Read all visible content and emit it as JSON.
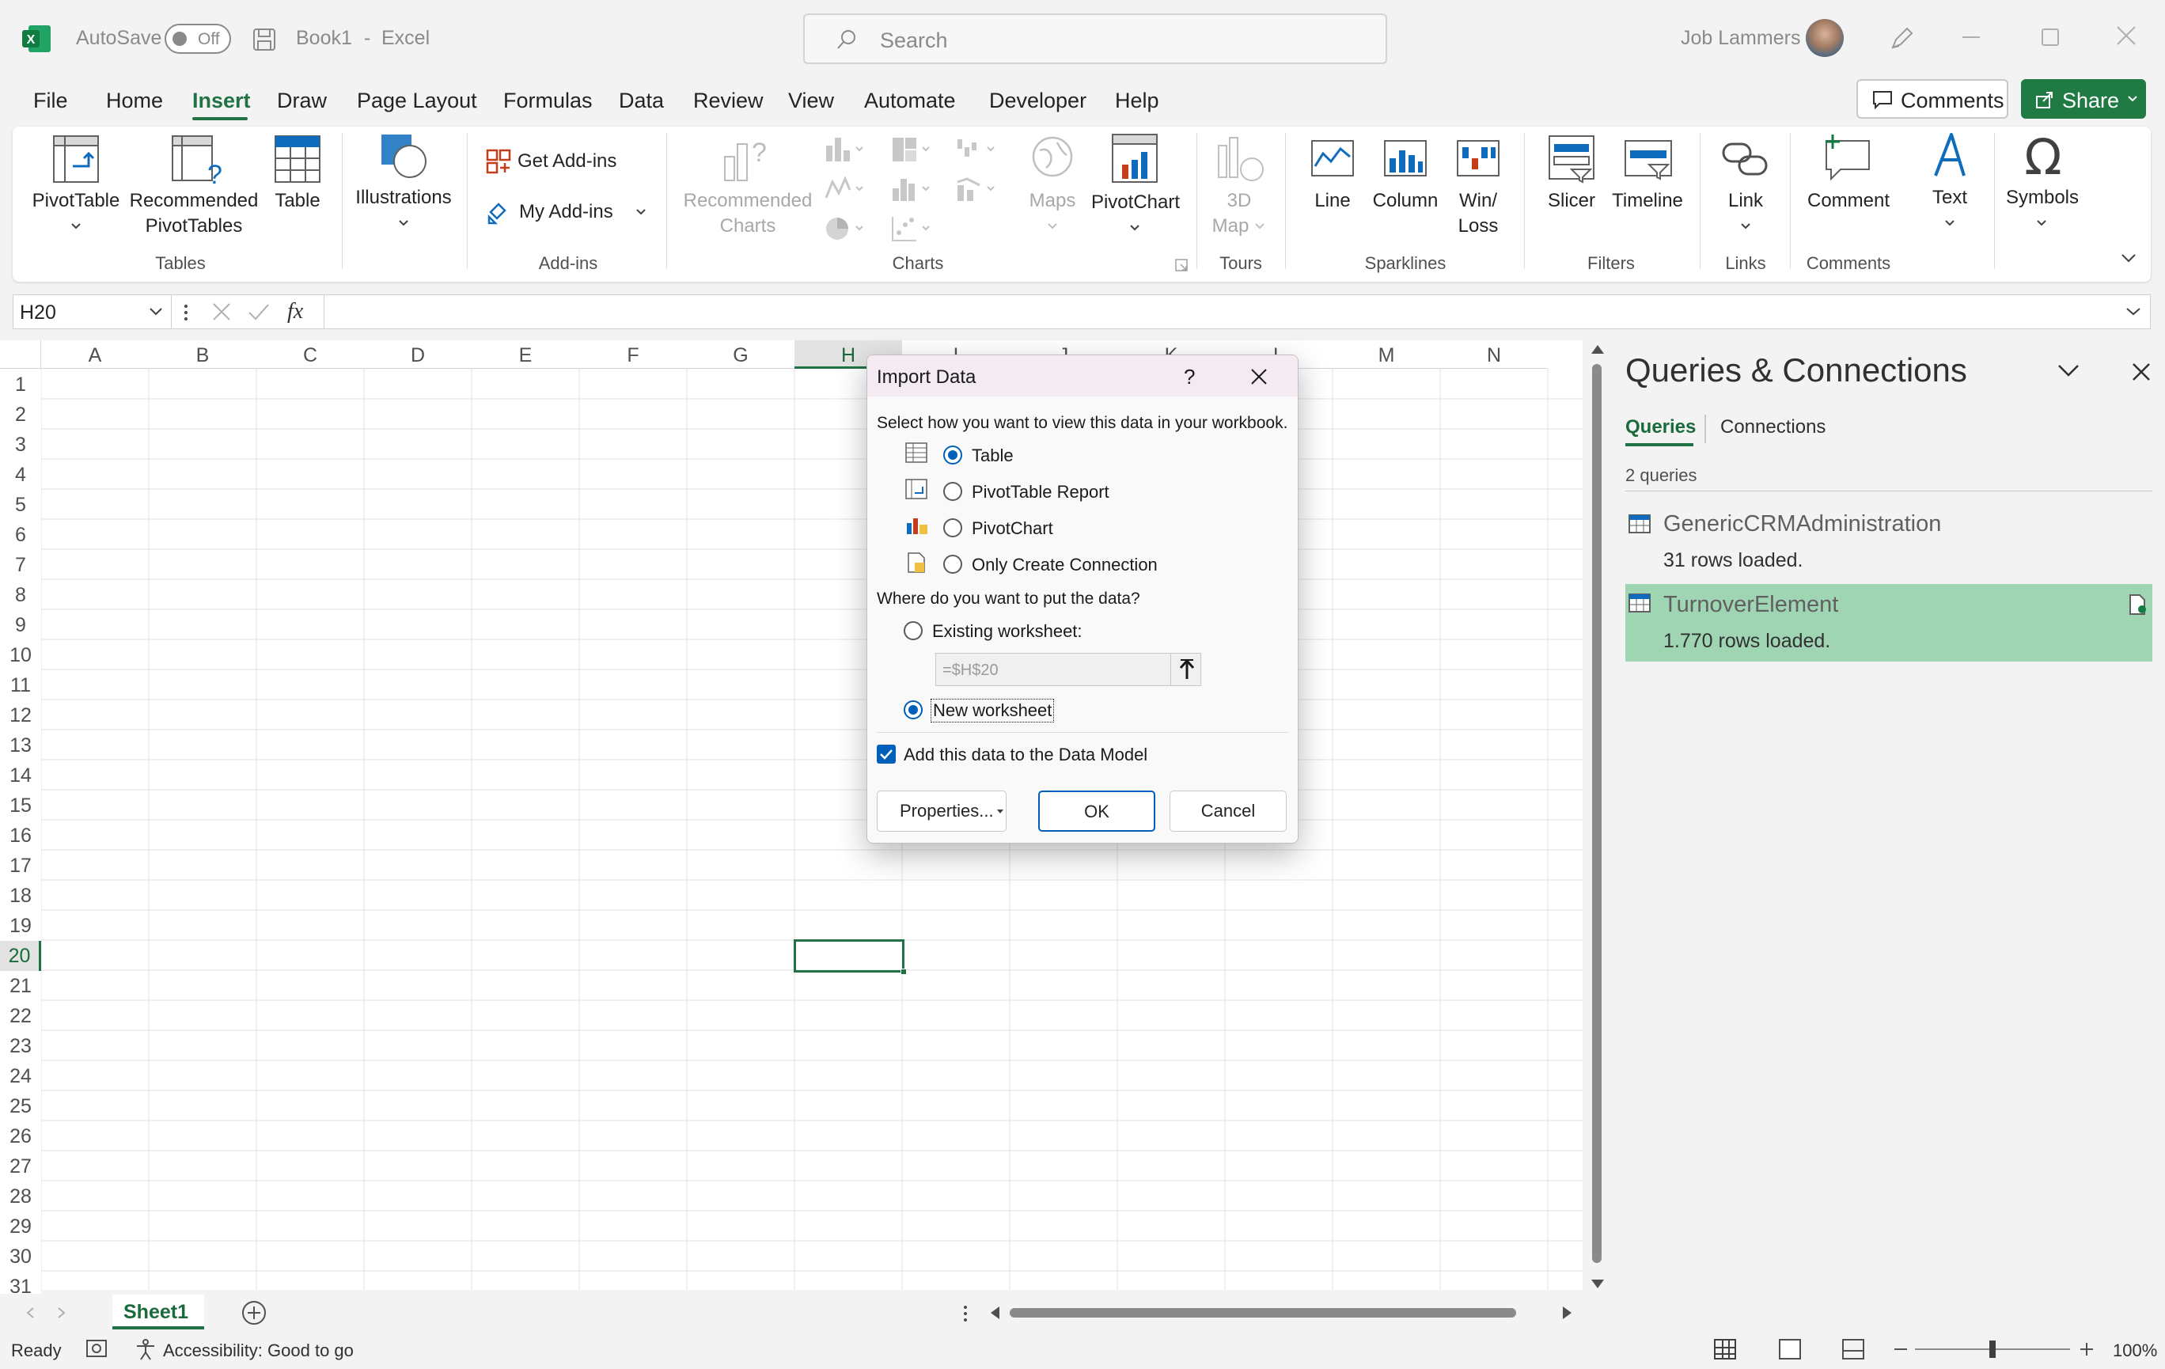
{
  "titlebar": {
    "autosave_label": "AutoSave",
    "autosave_state": "Off",
    "file_name": "Book1",
    "app_separator": "-",
    "app_name": "Excel",
    "search_placeholder": "Search",
    "user_name": "Job Lammers"
  },
  "menu": {
    "items": [
      "File",
      "Home",
      "Insert",
      "Draw",
      "Page Layout",
      "Formulas",
      "Data",
      "Review",
      "View",
      "Automate",
      "Developer",
      "Help"
    ],
    "active": "Insert",
    "comments_label": "Comments",
    "share_label": "Share"
  },
  "ribbon": {
    "pivottable": "PivotTable",
    "recommended_pivottables_1": "Recommended",
    "recommended_pivottables_2": "PivotTables",
    "table": "Table",
    "group_tables": "Tables",
    "illustrations": "Illustrations",
    "get_addins": "Get Add-ins",
    "my_addins": "My Add-ins",
    "group_addins": "Add-ins",
    "recommended_charts_1": "Recommended",
    "recommended_charts_2": "Charts",
    "maps": "Maps",
    "pivotchart": "PivotChart",
    "group_charts": "Charts",
    "map3d_1": "3D",
    "map3d_2": "Map",
    "group_tours": "Tours",
    "line": "Line",
    "column": "Column",
    "winloss_1": "Win/",
    "winloss_2": "Loss",
    "group_sparklines": "Sparklines",
    "slicer": "Slicer",
    "timeline": "Timeline",
    "group_filters": "Filters",
    "link": "Link",
    "group_links": "Links",
    "comment": "Comment",
    "group_comments": "Comments",
    "text": "Text",
    "symbols": "Symbols"
  },
  "formula_bar": {
    "name_box": "H20",
    "fx": "fx",
    "formula": ""
  },
  "grid": {
    "columns": [
      "A",
      "B",
      "C",
      "D",
      "E",
      "F",
      "G",
      "H",
      "I",
      "J",
      "K",
      "L",
      "M",
      "N"
    ],
    "rows": [
      "1",
      "2",
      "3",
      "4",
      "5",
      "6",
      "7",
      "8",
      "9",
      "10",
      "11",
      "12",
      "13",
      "14",
      "15",
      "16",
      "17",
      "18",
      "19",
      "20",
      "21",
      "22",
      "23",
      "24",
      "25",
      "26",
      "27",
      "28",
      "29",
      "30",
      "31"
    ],
    "selected_cell": "H20"
  },
  "dialog": {
    "title": "Import Data",
    "help": "?",
    "view_prompt": "Select how you want to view this data in your workbook.",
    "options": [
      "Table",
      "PivotTable Report",
      "PivotChart",
      "Only Create Connection"
    ],
    "selected_view": "Table",
    "location_prompt": "Where do you want to put the data?",
    "existing_worksheet": "Existing worksheet:",
    "range_value": "=$H$20",
    "new_worksheet": "New worksheet",
    "selected_location": "New worksheet",
    "data_model_label": "Add this data to the Data Model",
    "data_model_checked": true,
    "properties_button": "Properties...",
    "ok_button": "OK",
    "cancel_button": "Cancel"
  },
  "pane": {
    "title": "Queries & Connections",
    "tabs": [
      "Queries",
      "Connections"
    ],
    "active_tab": "Queries",
    "count": "2 queries",
    "queries": [
      {
        "name": "GenericCRMAdministration",
        "status": "31 rows loaded."
      },
      {
        "name": "TurnoverElement",
        "status": "1.770 rows loaded."
      }
    ],
    "highlight_color": "#9fd5b3"
  },
  "sheets": {
    "tabs": [
      "Sheet1"
    ]
  },
  "status": {
    "ready": "Ready",
    "accessibility": "Accessibility: Good to go",
    "zoom": "100%"
  },
  "colors": {
    "accent": "#217346",
    "dialog_accent": "#005fb8"
  }
}
